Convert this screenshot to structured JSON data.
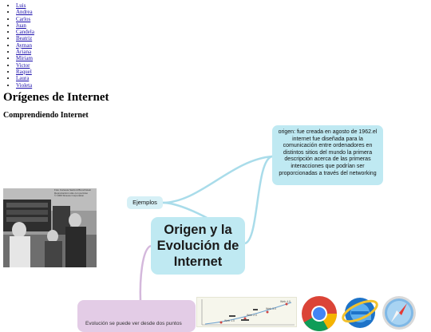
{
  "names": [
    "Luis",
    "Andrea",
    "Carlos",
    "Juan",
    "Candela",
    "Beatriz",
    "Ayman",
    "Ariana",
    "Miriam",
    "Victor",
    "Raquel",
    "Laura",
    "Violeta"
  ],
  "page": {
    "title": "Orígenes de Internet",
    "subtitle": "Comprendiendo Internet"
  },
  "mindmap": {
    "central": {
      "line1": "Origen y la",
      "line2": "Evolución de",
      "line3": "Internet"
    },
    "examples_label": "Ejemplos",
    "origin_text": "origen: fue creada en agosto de 1962.el internet fue diseñada para la comunicación entre ordenadores en distintos sitios del mundo la primera descripción acerca de las primeras interacciones que podrían ser proporcionadas a través del networking",
    "pink_node_text": "Evolución se puede ver desde dos puntos"
  },
  "photo": {
    "caption_line1": "Foto Cortesía Sanford Brunchstein",
    "caption_line2": "Reproducción sólo con permiso",
    "caption_line3": "© 1969 Strauss Corporation"
  },
  "timeline_labels": [
    "Web 4.0",
    "Web 3.0",
    "Web 2.0",
    "Web 1.0"
  ],
  "colors": {
    "node_fill": "#bfe9f2",
    "link_blue": "#a9dcea",
    "link_purple": "#d4b8dc",
    "pink_fill": "#e3cce6"
  },
  "icons": [
    "chrome-icon",
    "internet-explorer-icon",
    "safari-icon"
  ]
}
